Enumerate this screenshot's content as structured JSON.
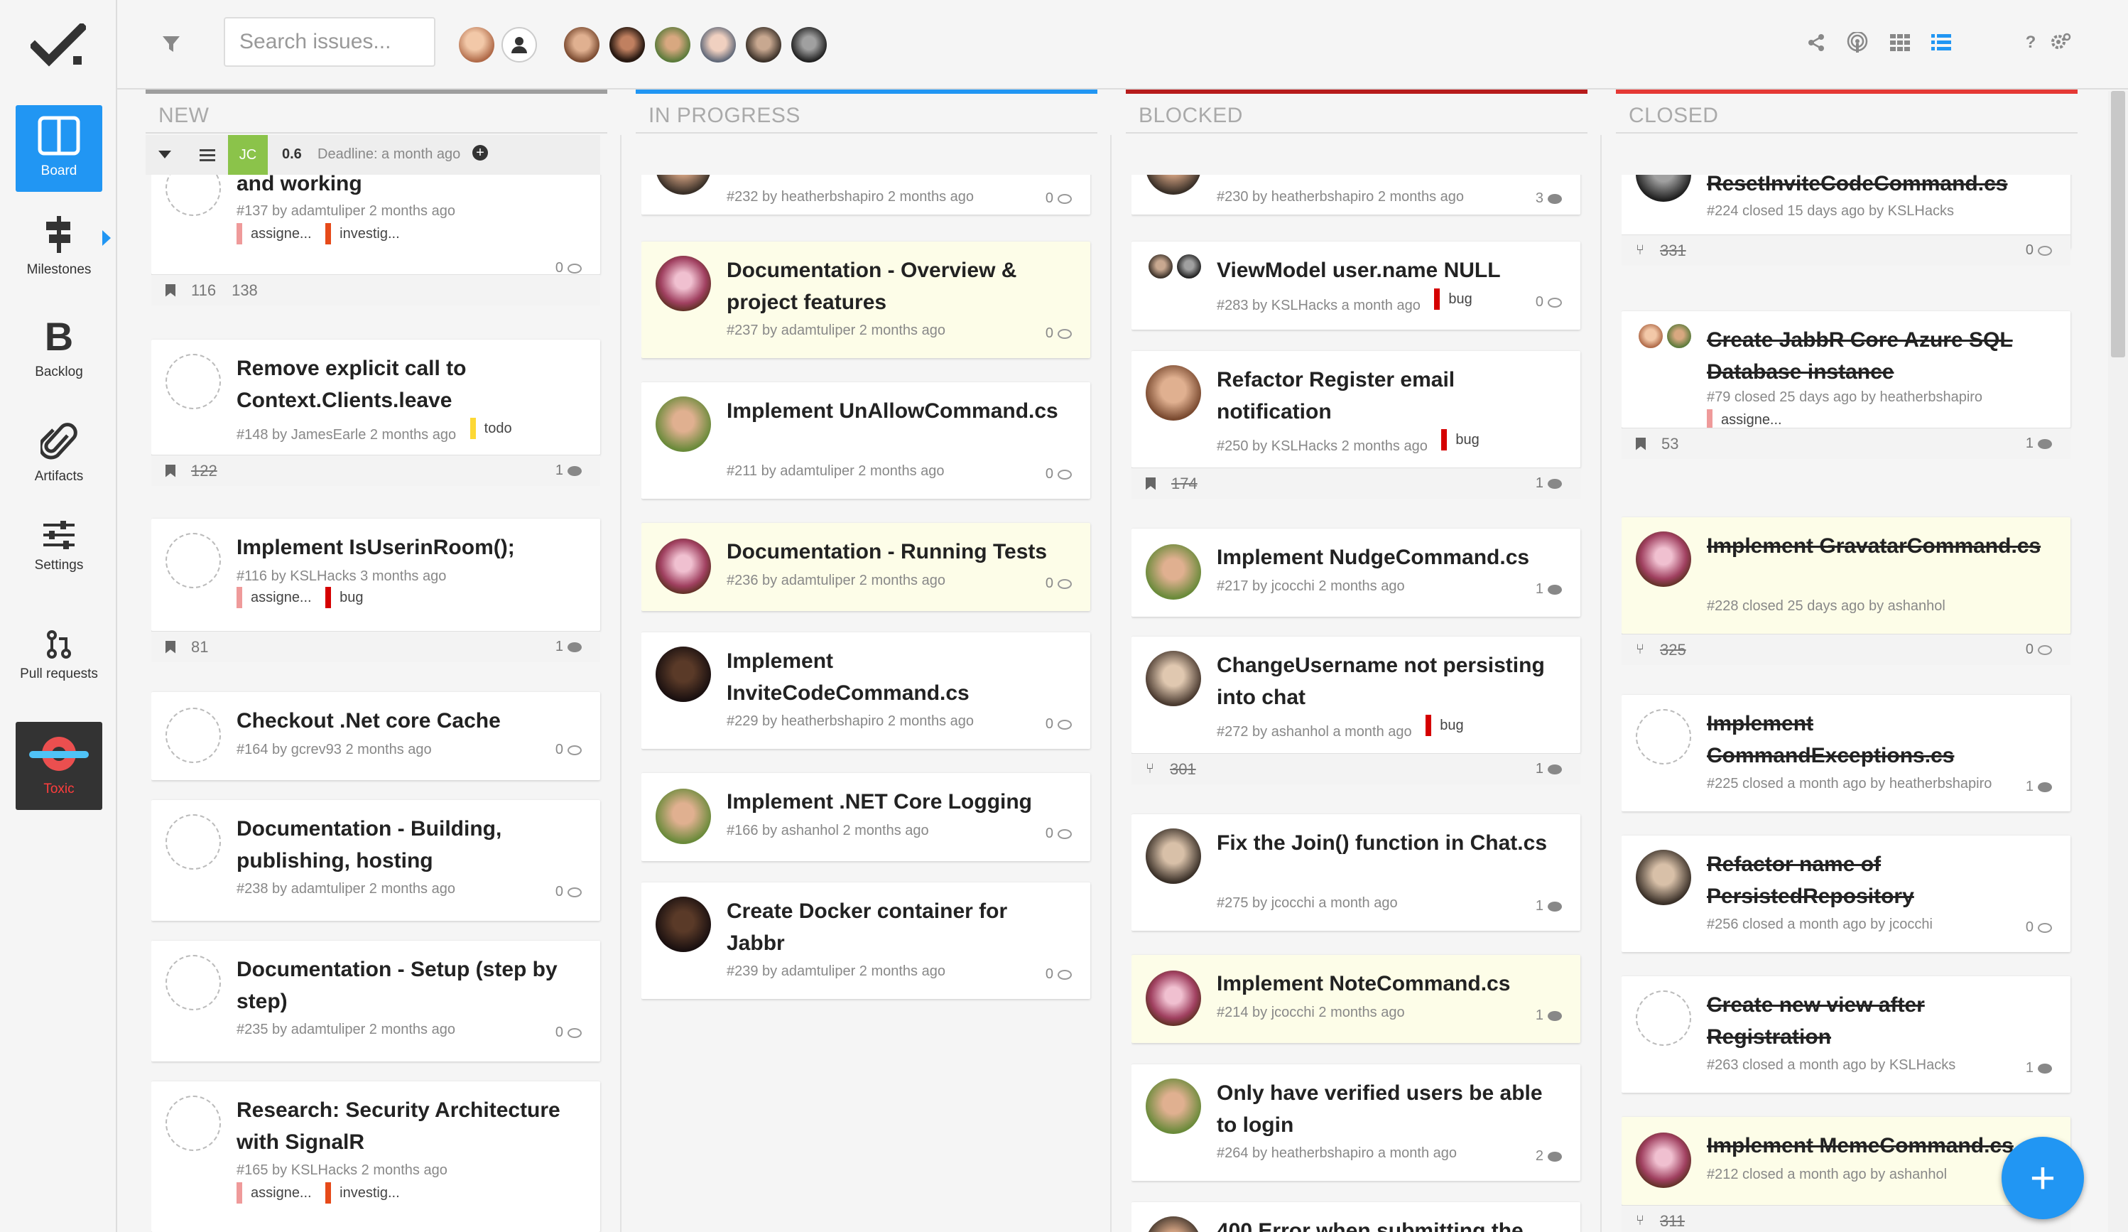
{
  "nav": {
    "logo": "check-logo",
    "items": [
      {
        "label": "Board",
        "icon": "board-icon"
      },
      {
        "label": "Milestones",
        "icon": "signpost-icon"
      },
      {
        "label": "Backlog",
        "icon": "backlog-icon"
      },
      {
        "label": "Artifacts",
        "icon": "paperclip-icon"
      },
      {
        "label": "Settings",
        "icon": "sliders-icon"
      },
      {
        "label": "Pull requests",
        "icon": "pull-request-icon"
      },
      {
        "label": "Toxic",
        "icon": "toxic-icon"
      }
    ]
  },
  "topbar": {
    "search_placeholder": "Search issues...",
    "filter_icon": "filter-icon",
    "right_icons": [
      "share-icon",
      "broadcast-icon",
      "grid-view-icon",
      "list-view-icon",
      "help-icon",
      "settings-icon"
    ]
  },
  "milestone": {
    "initials": "JC",
    "progress": "0.6",
    "deadline": "Deadline: a month ago"
  },
  "colors": {
    "new": "#9e9e9e",
    "in_progress": "#2196f3",
    "blocked": "#b71c1c",
    "closed": "#e53935",
    "bug": "#d50000",
    "todo": "#fdd835",
    "assigned": "#ef9a9a",
    "investigate": "#e64a19"
  },
  "columns": {
    "new": {
      "title": "NEW",
      "cards": [
        {
          "title": "and working",
          "meta": "#137 by adamtuliper 2 months ago",
          "comments": "0",
          "tag1": "assigne...",
          "tag2": "investig...",
          "foot_a": "116",
          "foot_b": "138"
        },
        {
          "title": "Remove explicit call to Context.Clients.leave",
          "meta": "#148 by JamesEarle 2 months ago",
          "comments": "1",
          "tag1": "todo",
          "foot_a": "122"
        },
        {
          "title": "Implement IsUserinRoom();",
          "meta": "#116 by KSLHacks 3 months ago",
          "comments": "1",
          "tag1": "assigne...",
          "tag2": "bug",
          "foot_a": "81"
        },
        {
          "title": "Checkout .Net core Cache",
          "meta": "#164 by gcrev93 2 months ago",
          "comments": "0"
        },
        {
          "title": "Documentation - Building, publishing, hosting",
          "meta": "#238 by adamtuliper 2 months ago",
          "comments": "0"
        },
        {
          "title": "Documentation - Setup (step by step)",
          "meta": "#235 by adamtuliper 2 months ago",
          "comments": "0"
        },
        {
          "title": "Research: Security Architecture with SignalR",
          "meta": "#165 by KSLHacks 2 months ago",
          "tag1": "assigne...",
          "tag2": "investig..."
        }
      ]
    },
    "in_progress": {
      "title": "IN PROGRESS",
      "cards": [
        {
          "meta": "#232 by heatherbshapiro 2 months ago",
          "comments": "0"
        },
        {
          "title": "Documentation - Overview & project features",
          "meta": "#237 by adamtuliper 2 months ago",
          "comments": "0"
        },
        {
          "title": "Implement UnAllowCommand.cs",
          "meta": "#211 by adamtuliper 2 months ago",
          "comments": "0"
        },
        {
          "title": "Documentation - Running Tests",
          "meta": "#236 by adamtuliper 2 months ago",
          "comments": "0"
        },
        {
          "title": "Implement InviteCodeCommand.cs",
          "meta": "#229 by heatherbshapiro 2 months ago",
          "comments": "0"
        },
        {
          "title": "Implement .NET Core Logging",
          "meta": "#166 by ashanhol 2 months ago",
          "comments": "0"
        },
        {
          "title": "Create Docker container for Jabbr",
          "meta": "#239 by adamtuliper 2 months ago",
          "comments": "0"
        }
      ]
    },
    "blocked": {
      "title": "BLOCKED",
      "cards": [
        {
          "meta": "#230 by heatherbshapiro 2 months ago",
          "comments": "3"
        },
        {
          "title": "ViewModel user.name NULL",
          "meta": "#283 by KSLHacks a month ago",
          "comments": "0",
          "tag1": "bug"
        },
        {
          "title": "Refactor Register email notification",
          "meta": "#250 by KSLHacks 2 months ago",
          "comments": "1",
          "tag1": "bug",
          "foot_a": "174"
        },
        {
          "title": "Implement NudgeCommand.cs",
          "meta": "#217 by jcocchi 2 months ago",
          "comments": "1"
        },
        {
          "title": "ChangeUsername not persisting into chat",
          "meta": "#272 by ashanhol a month ago",
          "comments": "1",
          "tag1": "bug",
          "foot_a": "301"
        },
        {
          "title": "Fix the Join() function in Chat.cs",
          "meta": "#275 by jcocchi a month ago",
          "comments": "1"
        },
        {
          "title": "Implement NoteCommand.cs",
          "meta": "#214 by jcocchi 2 months ago",
          "comments": "1"
        },
        {
          "title": "Only have verified users be able to login",
          "meta": "#264 by heatherbshapiro a month ago",
          "comments": "2"
        },
        {
          "title": "400 Error when submitting the"
        }
      ]
    },
    "closed": {
      "title": "CLOSED",
      "cards": [
        {
          "title": "ResetInviteCodeCommand.cs",
          "meta": "#224 closed 15 days ago by KSLHacks",
          "comments": "0",
          "foot_a": "331"
        },
        {
          "title": "Create JabbR Core Azure SQL Database instance",
          "meta": "#79 closed 25 days ago by heatherbshapiro",
          "comments": "1",
          "tag1": "assigne...",
          "foot_a": "53"
        },
        {
          "title": "Implement GravatarCommand.cs",
          "meta": "#228 closed 25 days ago by ashanhol",
          "comments": "0",
          "foot_a": "325"
        },
        {
          "title": "Implement CommandExceptions.cs",
          "meta": "#225 closed a month ago by heatherbshapiro",
          "comments": "1"
        },
        {
          "title": "Refactor name of PersistedRepository",
          "meta": "#256 closed a month ago by jcocchi",
          "comments": "0"
        },
        {
          "title": "Create new view after Registration",
          "meta": "#263 closed a month ago by KSLHacks",
          "comments": "1"
        },
        {
          "title": "Implement MemeCommand.cs",
          "meta": "#212 closed a month ago by ashanhol",
          "comments": "1",
          "foot_a": "311"
        }
      ]
    }
  },
  "fab_label": "+"
}
